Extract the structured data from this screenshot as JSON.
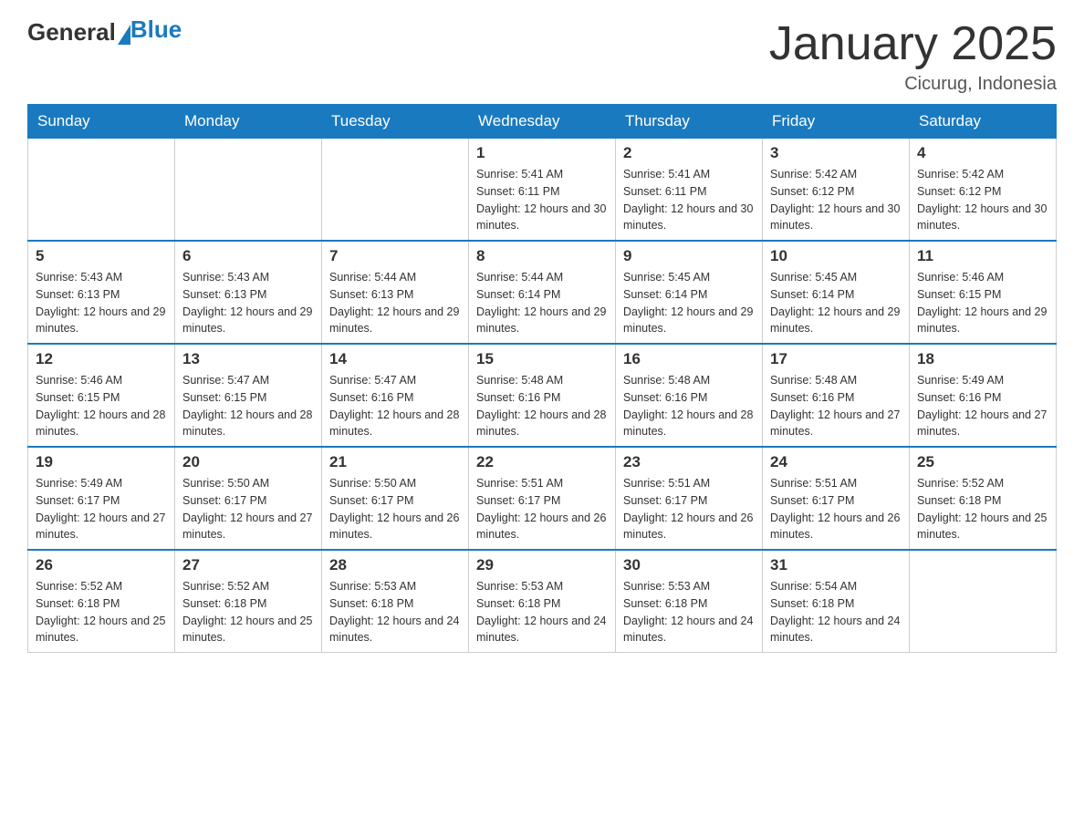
{
  "header": {
    "logo_general": "General",
    "logo_blue": "Blue",
    "title": "January 2025",
    "subtitle": "Cicurug, Indonesia"
  },
  "days_of_week": [
    "Sunday",
    "Monday",
    "Tuesday",
    "Wednesday",
    "Thursday",
    "Friday",
    "Saturday"
  ],
  "weeks": [
    [
      {
        "day": "",
        "sunrise": "",
        "sunset": "",
        "daylight": ""
      },
      {
        "day": "",
        "sunrise": "",
        "sunset": "",
        "daylight": ""
      },
      {
        "day": "",
        "sunrise": "",
        "sunset": "",
        "daylight": ""
      },
      {
        "day": "1",
        "sunrise": "Sunrise: 5:41 AM",
        "sunset": "Sunset: 6:11 PM",
        "daylight": "Daylight: 12 hours and 30 minutes."
      },
      {
        "day": "2",
        "sunrise": "Sunrise: 5:41 AM",
        "sunset": "Sunset: 6:11 PM",
        "daylight": "Daylight: 12 hours and 30 minutes."
      },
      {
        "day": "3",
        "sunrise": "Sunrise: 5:42 AM",
        "sunset": "Sunset: 6:12 PM",
        "daylight": "Daylight: 12 hours and 30 minutes."
      },
      {
        "day": "4",
        "sunrise": "Sunrise: 5:42 AM",
        "sunset": "Sunset: 6:12 PM",
        "daylight": "Daylight: 12 hours and 30 minutes."
      }
    ],
    [
      {
        "day": "5",
        "sunrise": "Sunrise: 5:43 AM",
        "sunset": "Sunset: 6:13 PM",
        "daylight": "Daylight: 12 hours and 29 minutes."
      },
      {
        "day": "6",
        "sunrise": "Sunrise: 5:43 AM",
        "sunset": "Sunset: 6:13 PM",
        "daylight": "Daylight: 12 hours and 29 minutes."
      },
      {
        "day": "7",
        "sunrise": "Sunrise: 5:44 AM",
        "sunset": "Sunset: 6:13 PM",
        "daylight": "Daylight: 12 hours and 29 minutes."
      },
      {
        "day": "8",
        "sunrise": "Sunrise: 5:44 AM",
        "sunset": "Sunset: 6:14 PM",
        "daylight": "Daylight: 12 hours and 29 minutes."
      },
      {
        "day": "9",
        "sunrise": "Sunrise: 5:45 AM",
        "sunset": "Sunset: 6:14 PM",
        "daylight": "Daylight: 12 hours and 29 minutes."
      },
      {
        "day": "10",
        "sunrise": "Sunrise: 5:45 AM",
        "sunset": "Sunset: 6:14 PM",
        "daylight": "Daylight: 12 hours and 29 minutes."
      },
      {
        "day": "11",
        "sunrise": "Sunrise: 5:46 AM",
        "sunset": "Sunset: 6:15 PM",
        "daylight": "Daylight: 12 hours and 29 minutes."
      }
    ],
    [
      {
        "day": "12",
        "sunrise": "Sunrise: 5:46 AM",
        "sunset": "Sunset: 6:15 PM",
        "daylight": "Daylight: 12 hours and 28 minutes."
      },
      {
        "day": "13",
        "sunrise": "Sunrise: 5:47 AM",
        "sunset": "Sunset: 6:15 PM",
        "daylight": "Daylight: 12 hours and 28 minutes."
      },
      {
        "day": "14",
        "sunrise": "Sunrise: 5:47 AM",
        "sunset": "Sunset: 6:16 PM",
        "daylight": "Daylight: 12 hours and 28 minutes."
      },
      {
        "day": "15",
        "sunrise": "Sunrise: 5:48 AM",
        "sunset": "Sunset: 6:16 PM",
        "daylight": "Daylight: 12 hours and 28 minutes."
      },
      {
        "day": "16",
        "sunrise": "Sunrise: 5:48 AM",
        "sunset": "Sunset: 6:16 PM",
        "daylight": "Daylight: 12 hours and 28 minutes."
      },
      {
        "day": "17",
        "sunrise": "Sunrise: 5:48 AM",
        "sunset": "Sunset: 6:16 PM",
        "daylight": "Daylight: 12 hours and 27 minutes."
      },
      {
        "day": "18",
        "sunrise": "Sunrise: 5:49 AM",
        "sunset": "Sunset: 6:16 PM",
        "daylight": "Daylight: 12 hours and 27 minutes."
      }
    ],
    [
      {
        "day": "19",
        "sunrise": "Sunrise: 5:49 AM",
        "sunset": "Sunset: 6:17 PM",
        "daylight": "Daylight: 12 hours and 27 minutes."
      },
      {
        "day": "20",
        "sunrise": "Sunrise: 5:50 AM",
        "sunset": "Sunset: 6:17 PM",
        "daylight": "Daylight: 12 hours and 27 minutes."
      },
      {
        "day": "21",
        "sunrise": "Sunrise: 5:50 AM",
        "sunset": "Sunset: 6:17 PM",
        "daylight": "Daylight: 12 hours and 26 minutes."
      },
      {
        "day": "22",
        "sunrise": "Sunrise: 5:51 AM",
        "sunset": "Sunset: 6:17 PM",
        "daylight": "Daylight: 12 hours and 26 minutes."
      },
      {
        "day": "23",
        "sunrise": "Sunrise: 5:51 AM",
        "sunset": "Sunset: 6:17 PM",
        "daylight": "Daylight: 12 hours and 26 minutes."
      },
      {
        "day": "24",
        "sunrise": "Sunrise: 5:51 AM",
        "sunset": "Sunset: 6:17 PM",
        "daylight": "Daylight: 12 hours and 26 minutes."
      },
      {
        "day": "25",
        "sunrise": "Sunrise: 5:52 AM",
        "sunset": "Sunset: 6:18 PM",
        "daylight": "Daylight: 12 hours and 25 minutes."
      }
    ],
    [
      {
        "day": "26",
        "sunrise": "Sunrise: 5:52 AM",
        "sunset": "Sunset: 6:18 PM",
        "daylight": "Daylight: 12 hours and 25 minutes."
      },
      {
        "day": "27",
        "sunrise": "Sunrise: 5:52 AM",
        "sunset": "Sunset: 6:18 PM",
        "daylight": "Daylight: 12 hours and 25 minutes."
      },
      {
        "day": "28",
        "sunrise": "Sunrise: 5:53 AM",
        "sunset": "Sunset: 6:18 PM",
        "daylight": "Daylight: 12 hours and 24 minutes."
      },
      {
        "day": "29",
        "sunrise": "Sunrise: 5:53 AM",
        "sunset": "Sunset: 6:18 PM",
        "daylight": "Daylight: 12 hours and 24 minutes."
      },
      {
        "day": "30",
        "sunrise": "Sunrise: 5:53 AM",
        "sunset": "Sunset: 6:18 PM",
        "daylight": "Daylight: 12 hours and 24 minutes."
      },
      {
        "day": "31",
        "sunrise": "Sunrise: 5:54 AM",
        "sunset": "Sunset: 6:18 PM",
        "daylight": "Daylight: 12 hours and 24 minutes."
      },
      {
        "day": "",
        "sunrise": "",
        "sunset": "",
        "daylight": ""
      }
    ]
  ]
}
